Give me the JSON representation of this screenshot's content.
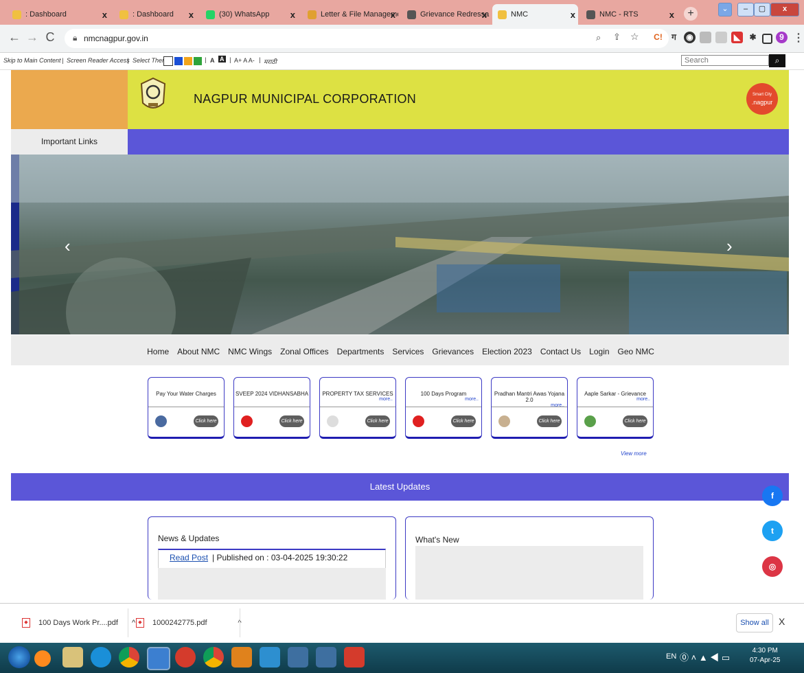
{
  "browser": {
    "tabs": [
      {
        "label": ": Dashboard",
        "fav": "#f0c040"
      },
      {
        "label": ": Dashboard",
        "fav": "#f0c040"
      },
      {
        "label": "(30) WhatsApp",
        "fav": "#25d366"
      },
      {
        "label": "Letter & File Manageme",
        "fav": "#e0a030"
      },
      {
        "label": "Grievance Redressal Sys",
        "fav": "#555555"
      },
      {
        "label": "NMC",
        "fav": "#f0c040"
      },
      {
        "label": "NMC - RTS",
        "fav": "#555555"
      }
    ],
    "url": "nmcnagpur.gov.in",
    "profile_letter": "9"
  },
  "accessibility": {
    "skip": "Skip to Main Content",
    "reader": "Screen Reader Access",
    "theme": "Select Theme",
    "font_a": "A",
    "font_sizes": "A+  A  A-",
    "lang": "मराठी",
    "search_placeholder": "Search"
  },
  "header": {
    "title": "NAGPUR MUNICIPAL CORPORATION",
    "badge_top": "Smart City",
    "badge_bottom": ".nagpur",
    "important_links": "Important Links"
  },
  "menu": [
    "Home",
    "About NMC",
    "NMC Wings",
    "Zonal Offices",
    "Departments",
    "Services",
    "Grievances",
    "Election 2023",
    "Contact Us",
    "Login",
    "Geo NMC"
  ],
  "cards": [
    {
      "title": "Pay Your Water Charges",
      "more": "",
      "icon_color": "#4a6aa0"
    },
    {
      "title": "SVEEP 2024 VIDHANSABHA",
      "more": "",
      "icon_color": "#e02020"
    },
    {
      "title": "PROPERTY TAX SERVICES",
      "more": "more..",
      "icon_color": "#dddddd"
    },
    {
      "title": "100 Days Program",
      "more": "more..",
      "icon_color": "#e02020"
    },
    {
      "title": "Pradhan Mantri Awas Yojana 2.0",
      "more": "more..",
      "icon_color": "#c8b090"
    },
    {
      "title": "Aaple Sarkar - Grievance",
      "more": "more..",
      "icon_color": "#5aa04a"
    }
  ],
  "card_button": "Click here",
  "view_more": "View more",
  "latest_updates": "Latest Updates",
  "news": {
    "title": "News & Updates",
    "read_post": "Read Post",
    "published": " | Published on : 03-04-2025 19:30:22"
  },
  "whats_new": {
    "title": "What's New"
  },
  "social": [
    {
      "name": "facebook-icon",
      "glyph": "f",
      "color": "#1877f2"
    },
    {
      "name": "twitter-icon",
      "glyph": "t",
      "color": "#1da1f2"
    },
    {
      "name": "instagram-icon",
      "glyph": "◎",
      "color": "#dc3545"
    }
  ],
  "downloads": {
    "items": [
      "100 Days Work Pr....pdf",
      "1000242775.pdf"
    ],
    "show_all": "Show all"
  },
  "taskbar": {
    "lang": "EN",
    "time": "4:30 PM",
    "date": "07-Apr-25"
  }
}
